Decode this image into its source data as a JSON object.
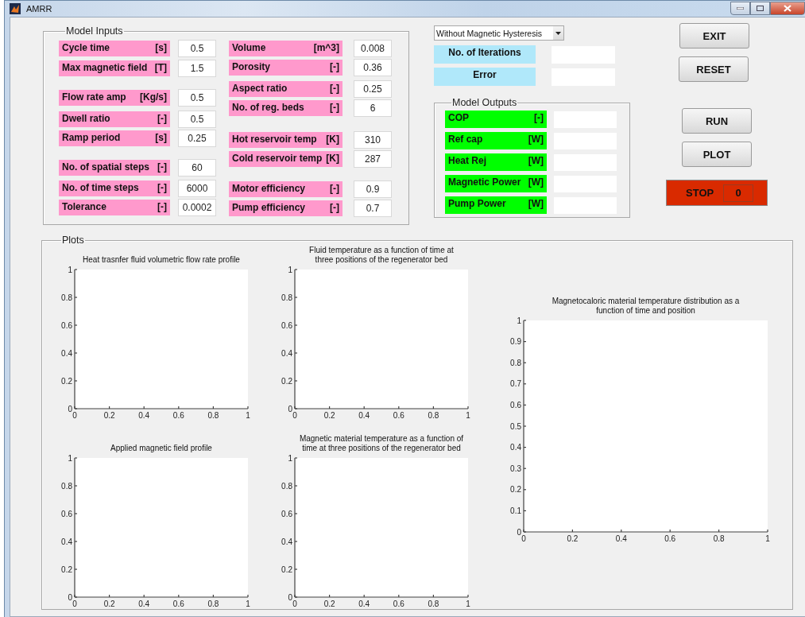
{
  "window": {
    "title": "AMRR"
  },
  "model_inputs": {
    "title": "Model Inputs",
    "left": [
      {
        "label": "Cycle time",
        "unit": "[s]",
        "value": "0.5"
      },
      {
        "label": "Max magnetic field",
        "unit": "[T]",
        "value": "1.5"
      },
      {
        "label": "Flow rate amp",
        "unit": "[Kg/s]",
        "value": "0.5"
      },
      {
        "label": "Dwell ratio",
        "unit": "[-]",
        "value": "0.5"
      },
      {
        "label": "Ramp period",
        "unit": "[s]",
        "value": "0.25"
      },
      {
        "label": "No. of spatial steps",
        "unit": "[-]",
        "value": "60"
      },
      {
        "label": "No. of time steps",
        "unit": "[-]",
        "value": "6000"
      },
      {
        "label": "Tolerance",
        "unit": "[-]",
        "value": "0.0002"
      }
    ],
    "right": [
      {
        "label": "Volume",
        "unit": "[m^3]",
        "value": "0.008"
      },
      {
        "label": "Porosity",
        "unit": "[-]",
        "value": "0.36"
      },
      {
        "label": "Aspect ratio",
        "unit": "[-]",
        "value": "0.25"
      },
      {
        "label": "No. of reg. beds",
        "unit": "[-]",
        "value": "6"
      },
      {
        "label": "Hot reservoir temp",
        "unit": "[K]",
        "value": "310"
      },
      {
        "label": "Cold reservoir temp",
        "unit": "[K]",
        "value": "287"
      },
      {
        "label": "Motor efficiency",
        "unit": "[-]",
        "value": "0.9"
      },
      {
        "label": "Pump efficiency",
        "unit": "[-]",
        "value": "0.7"
      }
    ]
  },
  "mode_dropdown": {
    "value": "Without Magnetic Hysteresis"
  },
  "status": [
    {
      "label": "No. of Iterations"
    },
    {
      "label": "Error"
    }
  ],
  "model_outputs": {
    "title": "Model Outputs",
    "items": [
      {
        "label": "COP",
        "unit": "[-]"
      },
      {
        "label": "Ref cap",
        "unit": "[W]"
      },
      {
        "label": "Heat Rej",
        "unit": "[W]"
      },
      {
        "label": "Magnetic Power",
        "unit": "[W]"
      },
      {
        "label": "Pump Power",
        "unit": "[W]"
      }
    ]
  },
  "buttons": [
    {
      "label": "EXIT"
    },
    {
      "label": "RESET"
    },
    {
      "label": "RUN"
    },
    {
      "label": "PLOT"
    }
  ],
  "stop": {
    "label": "STOP",
    "value": "0"
  },
  "plots": {
    "title": "Plots",
    "charts": [
      {
        "chart_data": {
          "type": "line",
          "title": "Heat trasnfer fluid volumetric flow rate profile",
          "xlim": [
            0,
            1
          ],
          "ylim": [
            0,
            1
          ],
          "xticks": [
            0,
            0.2,
            0.4,
            0.6,
            0.8,
            1
          ],
          "yticks": [
            0,
            0.2,
            0.4,
            0.6,
            0.8,
            1
          ]
        }
      },
      {
        "chart_data": {
          "type": "line",
          "title": "Fluid temperature as a function of time at three positions of the regenerator bed",
          "xlim": [
            0,
            1
          ],
          "ylim": [
            0,
            1
          ],
          "xticks": [
            0,
            0.2,
            0.4,
            0.6,
            0.8,
            1
          ],
          "yticks": [
            0,
            0.2,
            0.4,
            0.6,
            0.8,
            1
          ]
        }
      },
      {
        "chart_data": {
          "type": "line",
          "title": "Magnetocaloric material temperature distribution as a function of time and position",
          "xlim": [
            0,
            1
          ],
          "ylim": [
            0,
            1
          ],
          "xticks": [
            0,
            0.2,
            0.4,
            0.6,
            0.8,
            1
          ],
          "yticks": [
            0,
            0.1,
            0.2,
            0.3,
            0.4,
            0.5,
            0.6,
            0.7,
            0.8,
            0.9,
            1
          ]
        }
      },
      {
        "chart_data": {
          "type": "line",
          "title": "Applied magnetic field profile",
          "xlim": [
            0,
            1
          ],
          "ylim": [
            0,
            1
          ],
          "xticks": [
            0,
            0.2,
            0.4,
            0.6,
            0.8,
            1
          ],
          "yticks": [
            0,
            0.2,
            0.4,
            0.6,
            0.8,
            1
          ]
        }
      },
      {
        "chart_data": {
          "type": "line",
          "title": "Magnetic material temperature as a function of time at three positions of the regenerator bed",
          "xlim": [
            0,
            1
          ],
          "ylim": [
            0,
            1
          ],
          "xticks": [
            0,
            0.2,
            0.4,
            0.6,
            0.8,
            1
          ],
          "yticks": [
            0,
            0.2,
            0.4,
            0.6,
            0.8,
            1
          ]
        }
      }
    ]
  }
}
